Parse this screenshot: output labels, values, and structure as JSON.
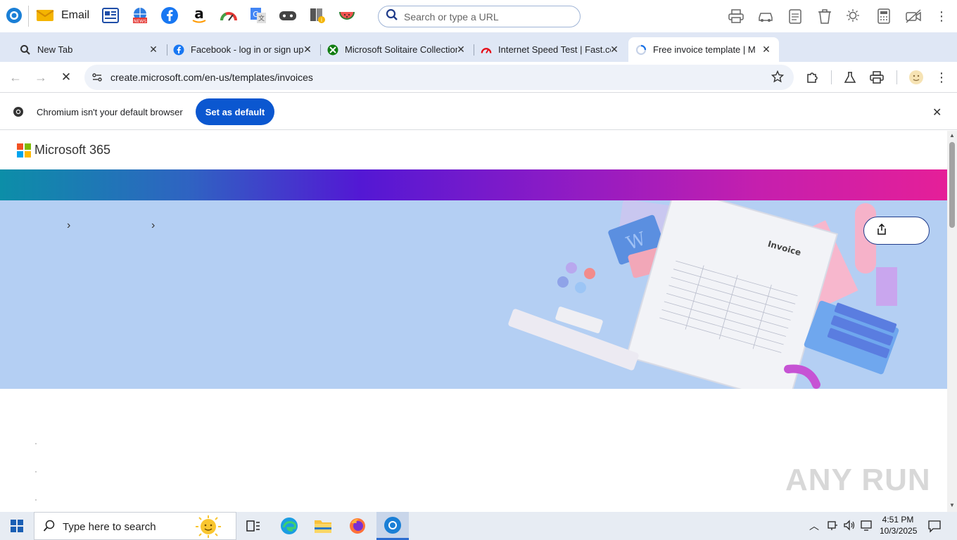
{
  "quickbar": {
    "email_label": "Email",
    "search_placeholder": "Search or type a URL"
  },
  "tabs": [
    {
      "title": "New Tab",
      "favicon": "search-icon"
    },
    {
      "title": "Facebook - log in or sign up",
      "favicon": "facebook-icon"
    },
    {
      "title": "Microsoft Solitaire Collection",
      "favicon": "xbox-icon"
    },
    {
      "title": "Internet Speed Test | Fast.com",
      "favicon": "speedometer-icon"
    },
    {
      "title": "Free invoice template | Micro",
      "favicon": "chrome-loading-icon",
      "active": true
    }
  ],
  "toolbar": {
    "url": "create.microsoft.com/en-us/templates/invoices"
  },
  "infobar": {
    "message": "Chromium isn't your default browser",
    "button": "Set as default"
  },
  "page": {
    "brand": "Microsoft 365"
  },
  "taskbar": {
    "search_placeholder": "Type here to search",
    "time": "4:51 PM",
    "date": "10/3/2025"
  },
  "watermark": "ANY RUN",
  "colors": {
    "accent_blue": "#0b57d0",
    "tab_strip": "#dfe7f5",
    "hero_bg": "#b4cff3"
  }
}
